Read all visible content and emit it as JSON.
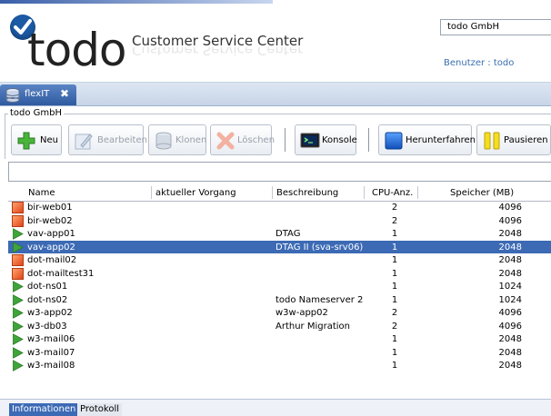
{
  "header": {
    "logo_text": "todo",
    "app_title": "Customer Service Center",
    "company_value": "todo GmbH",
    "user_label": "Benutzer : todo"
  },
  "tab": {
    "label": "flexIT",
    "close": "✖"
  },
  "group": {
    "legend": "todo GmbH"
  },
  "toolbar": {
    "neu": "Neu",
    "bearbeiten": "Bearbeiten",
    "klonen": "Klonen",
    "loeschen": "Löschen",
    "konsole": "Konsole",
    "herunterfahren": "Herunterfahren",
    "pausieren": "Pausieren"
  },
  "filter": {
    "value": ""
  },
  "table": {
    "columns": [
      "Name",
      "aktueller Vorgang",
      "Beschreibung",
      "CPU-Anz.",
      "Speicher (MB)"
    ],
    "rows": [
      {
        "status": "stopped",
        "name": "bir-web01",
        "vorgang": "",
        "beschreibung": "",
        "cpu": "2",
        "speicher": "4096"
      },
      {
        "status": "stopped",
        "name": "bir-web02",
        "vorgang": "",
        "beschreibung": "",
        "cpu": "2",
        "speicher": "4096"
      },
      {
        "status": "running",
        "name": "vav-app01",
        "vorgang": "",
        "beschreibung": "DTAG",
        "cpu": "1",
        "speicher": "2048"
      },
      {
        "status": "running",
        "name": "vav-app02",
        "vorgang": "",
        "beschreibung": "DTAG II (sva-srv06)",
        "cpu": "1",
        "speicher": "2048",
        "selected": true
      },
      {
        "status": "stopped",
        "name": "dot-mail02",
        "vorgang": "",
        "beschreibung": "",
        "cpu": "1",
        "speicher": "2048"
      },
      {
        "status": "stopped",
        "name": "dot-mailtest31",
        "vorgang": "",
        "beschreibung": "",
        "cpu": "1",
        "speicher": "2048"
      },
      {
        "status": "running",
        "name": "dot-ns01",
        "vorgang": "",
        "beschreibung": "",
        "cpu": "1",
        "speicher": "1024"
      },
      {
        "status": "running",
        "name": "dot-ns02",
        "vorgang": "",
        "beschreibung": "todo Nameserver 2",
        "cpu": "1",
        "speicher": "1024"
      },
      {
        "status": "running",
        "name": "w3-app02",
        "vorgang": "",
        "beschreibung": "w3w-app02",
        "cpu": "2",
        "speicher": "4096"
      },
      {
        "status": "running",
        "name": "w3-db03",
        "vorgang": "",
        "beschreibung": "Arthur Migration",
        "cpu": "2",
        "speicher": "4096"
      },
      {
        "status": "running",
        "name": "w3-mail06",
        "vorgang": "",
        "beschreibung": "",
        "cpu": "1",
        "speicher": "2048"
      },
      {
        "status": "running",
        "name": "w3-mail07",
        "vorgang": "",
        "beschreibung": "",
        "cpu": "1",
        "speicher": "2048"
      },
      {
        "status": "running",
        "name": "w3-mail08",
        "vorgang": "",
        "beschreibung": "",
        "cpu": "1",
        "speicher": "2048"
      }
    ]
  },
  "bottom_tabs": {
    "informationen": "Informationen",
    "protokoll": "Protokoll"
  },
  "colors": {
    "selection": "#3c6ab5",
    "running": "#3fa53a",
    "stopped": "#e0461b",
    "brand_blue": "#1c5aa6"
  }
}
